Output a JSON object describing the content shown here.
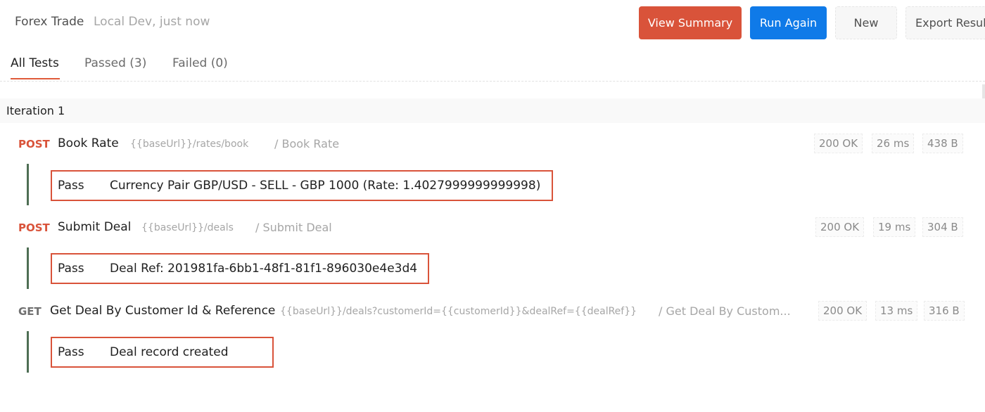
{
  "header": {
    "title": "Forex Trade",
    "subtitle": "Local Dev, just now",
    "buttons": {
      "view_summary": "View Summary",
      "run_again": "Run Again",
      "new": "New",
      "export_results": "Export Resul"
    }
  },
  "tabs": {
    "all": "All Tests",
    "passed": "Passed (3)",
    "failed": "Failed (0)"
  },
  "iteration": {
    "label": "Iteration 1"
  },
  "requests": [
    {
      "method": "POST",
      "name": "Book Rate",
      "url": "{{baseUrl}}/rates/book",
      "path": "/ Book Rate",
      "status": "200 OK",
      "time": "26 ms",
      "size": "438 B",
      "test": {
        "result": "Pass",
        "message": "Currency Pair GBP/USD - SELL - GBP 1000 (Rate: 1.4027999999999998)"
      }
    },
    {
      "method": "POST",
      "name": "Submit Deal",
      "url": "{{baseUrl}}/deals",
      "path": "/ Submit Deal",
      "status": "200 OK",
      "time": "19 ms",
      "size": "304 B",
      "test": {
        "result": "Pass",
        "message": "Deal Ref: 201981fa-6bb1-48f1-81f1-896030e4e3d4"
      }
    },
    {
      "method": "GET",
      "name": "Get Deal By Customer Id & Reference",
      "url": "{{baseUrl}}/deals?customerId={{customerId}}&dealRef={{dealRef}}",
      "path": "/ Get Deal By Custom...",
      "status": "200 OK",
      "time": "13 ms",
      "size": "316 B",
      "test": {
        "result": "Pass",
        "message": "Deal record created"
      }
    }
  ],
  "colors": {
    "accent_orange": "#d9533a",
    "accent_blue": "#0f7ae8",
    "pass_bar": "#4e6e54"
  }
}
